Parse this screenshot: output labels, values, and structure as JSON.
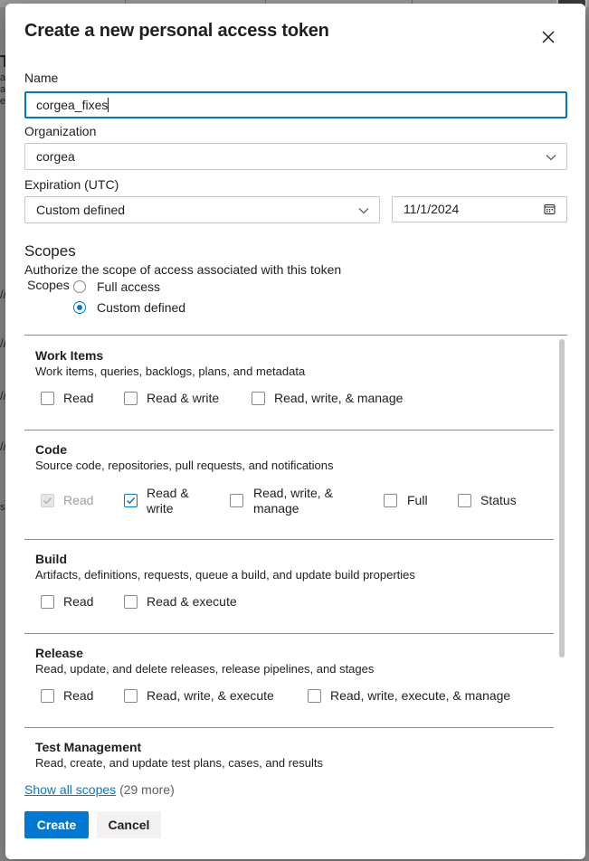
{
  "dialog": {
    "title": "Create a new personal access token"
  },
  "form": {
    "name_label": "Name",
    "name_value": "corgea_fixes",
    "org_label": "Organization",
    "org_value": "corgea",
    "expiration_label": "Expiration (UTC)",
    "expiration_value": "Custom defined",
    "date_value": "11/1/2024"
  },
  "scopes": {
    "title": "Scopes",
    "description": "Authorize the scope of access associated with this token",
    "label": "Scopes",
    "options": [
      {
        "label": "Full access",
        "selected": false
      },
      {
        "label": "Custom defined",
        "selected": true
      }
    ],
    "sections": [
      {
        "title": "Work Items",
        "description": "Work items, queries, backlogs, plans, and metadata",
        "checkboxes": [
          {
            "label": "Read",
            "checked": false,
            "disabled": false
          },
          {
            "label": "Read & write",
            "checked": false,
            "disabled": false
          },
          {
            "label": "Read, write, & manage",
            "checked": false,
            "disabled": false
          }
        ]
      },
      {
        "title": "Code",
        "description": "Source code, repositories, pull requests, and notifications",
        "checkboxes": [
          {
            "label": "Read",
            "checked": true,
            "disabled": true
          },
          {
            "label_line1": "Read &",
            "label_line2": "write",
            "checked": true,
            "disabled": false
          },
          {
            "label_line1": "Read, write, &",
            "label_line2": "manage",
            "checked": false,
            "disabled": false
          },
          {
            "label": "Full",
            "checked": false,
            "disabled": false
          },
          {
            "label": "Status",
            "checked": false,
            "disabled": false
          }
        ]
      },
      {
        "title": "Build",
        "description": "Artifacts, definitions, requests, queue a build, and update build properties",
        "checkboxes": [
          {
            "label": "Read",
            "checked": false,
            "disabled": false
          },
          {
            "label": "Read & execute",
            "checked": false,
            "disabled": false
          }
        ]
      },
      {
        "title": "Release",
        "description": "Read, update, and delete releases, release pipelines, and stages",
        "checkboxes": [
          {
            "label": "Read",
            "checked": false,
            "disabled": false
          },
          {
            "label": "Read, write, & execute",
            "checked": false,
            "disabled": false
          },
          {
            "label": "Read, write, execute, & manage",
            "checked": false,
            "disabled": false
          }
        ]
      },
      {
        "title": "Test Management",
        "description": "Read, create, and update test plans, cases, and results"
      }
    ]
  },
  "footer": {
    "show_all_link": "Show all scopes",
    "more_count": "(29 more)",
    "create_label": "Create",
    "cancel_label": "Cancel"
  },
  "background": {
    "glyphs": [
      "T",
      "ac",
      "a",
      "e",
      "//",
      "//",
      "//",
      "//",
      "s"
    ]
  },
  "colors": {
    "accent": "#0078d4",
    "text": "#201f1e",
    "border": "#8a8886",
    "overlay": "#8a8a8a"
  }
}
